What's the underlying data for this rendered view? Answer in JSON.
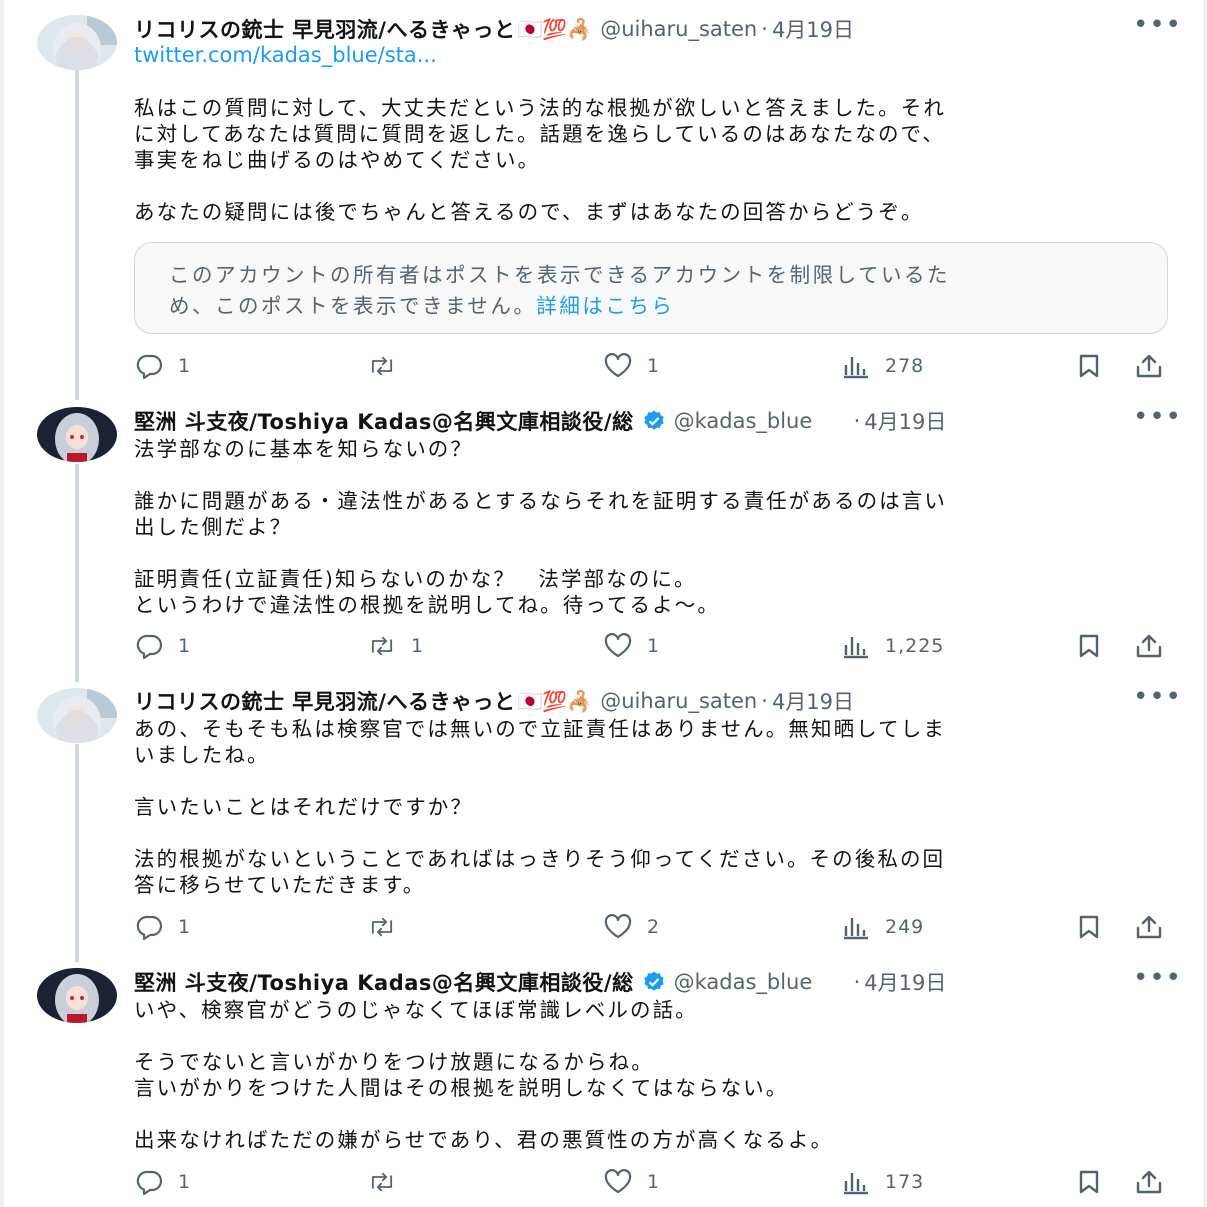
{
  "tweets": [
    {
      "name": "リコリスの銃士 早見羽流/へるきゃっと",
      "emoji": "🇯🇵💯🦂",
      "handle": "@uiharu_saten",
      "date": "4月19日",
      "link": "twitter.com/kadas_blue/sta...",
      "paragraphs": [
        [
          "私はこの質問に対して、大丈夫だという法的な根拠が欲しいと答えました。それ",
          "に対してあなたは質問に質問を返した。話題を逸らしているのはあなたなので、",
          "事実をねじ曲げるのはやめてください。"
        ],
        [
          "あなたの疑問には後でちゃんと答えるので、まずはあなたの回答からどうぞ。"
        ]
      ],
      "quote": {
        "line1": "このアカウントの所有者はポストを表示できるアカウントを制限しているた",
        "line2": "め、このポストを表示できません。",
        "more": "詳細はこちら"
      },
      "replies": "1",
      "reposts": "",
      "likes": "1",
      "views": "278"
    },
    {
      "name": "堅洲 斗支夜/Toshiya Kadas@名興文庫相談役/総",
      "handle": "@kadas_blue",
      "date": "4月19日",
      "paragraphs": [
        [
          "法学部なのに基本を知らないの？"
        ],
        [
          "誰かに問題がある・違法性があるとするならそれを証明する責任があるのは言い",
          "出した側だよ？"
        ],
        [
          "証明責任(立証責任)知らないのかな？　法学部なのに。",
          "というわけで違法性の根拠を説明してね。待ってるよ〜。"
        ]
      ],
      "replies": "1",
      "reposts": "1",
      "likes": "1",
      "views": "1,225"
    },
    {
      "name": "リコリスの銃士 早見羽流/へるきゃっと",
      "emoji": "🇯🇵💯🦂",
      "handle": "@uiharu_saten",
      "date": "4月19日",
      "paragraphs": [
        [
          "あの、そもそも私は検察官では無いので立証責任はありません。無知晒してしま",
          "いましたね。"
        ],
        [
          "言いたいことはそれだけですか？"
        ],
        [
          "法的根拠がないということであればはっきりそう仰ってください。その後私の回",
          "答に移らせていただきます。"
        ]
      ],
      "replies": "1",
      "reposts": "",
      "likes": "2",
      "views": "249"
    },
    {
      "name": "堅洲 斗支夜/Toshiya Kadas@名興文庫相談役/総",
      "handle": "@kadas_blue",
      "date": "4月19日",
      "paragraphs": [
        [
          "いや、検察官がどうのじゃなくてほぼ常識レベルの話。"
        ],
        [
          "そうでないと言いがかりをつけ放題になるからね。",
          "言いがかりをつけた人間はその根拠を説明しなくてはならない。"
        ],
        [
          "出来なければただの嫌がらせであり、君の悪質性の方が高くなるよ。"
        ]
      ],
      "replies": "1",
      "reposts": "",
      "likes": "1",
      "views": "173"
    }
  ],
  "separator": "·",
  "more_glyph": "•••",
  "colors": {
    "text": "#0f1419",
    "muted": "#536471",
    "link": "#1d9bf0",
    "verified": "#1d9bf0",
    "thread": "#cfd9de"
  }
}
